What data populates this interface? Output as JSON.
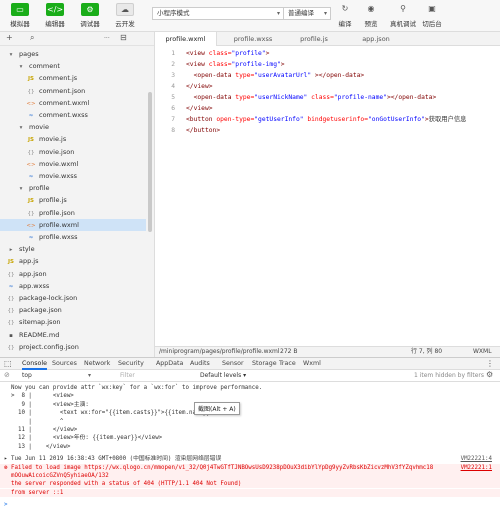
{
  "toolbar": {
    "buttons": [
      {
        "label": "模拟器",
        "icon": "simulator-icon"
      },
      {
        "label": "编辑器",
        "icon": "editor-icon"
      },
      {
        "label": "调试器",
        "icon": "debugger-icon"
      },
      {
        "label": "云开发",
        "icon": "cloud-icon"
      }
    ],
    "mode_select": "小程序模式",
    "compile_select": "普通编译",
    "right_buttons": [
      {
        "label": "编译",
        "icon": "compile-icon"
      },
      {
        "label": "预览",
        "icon": "preview-icon"
      },
      {
        "label": "真机调试",
        "icon": "remote-debug-icon"
      },
      {
        "label": "切后台",
        "icon": "background-icon"
      }
    ]
  },
  "explorer": {
    "add_glyph": "+",
    "search_glyph": "⌕",
    "more_glyph": "···",
    "collapse_glyph": "⊟",
    "items": [
      {
        "label": "pages",
        "type": "folder",
        "open": true,
        "level": 0
      },
      {
        "label": "comment",
        "type": "folder",
        "open": true,
        "level": 1
      },
      {
        "label": "comment.js",
        "type": "js",
        "level": 2
      },
      {
        "label": "comment.json",
        "type": "json",
        "level": 2
      },
      {
        "label": "comment.wxml",
        "type": "wxml",
        "level": 2
      },
      {
        "label": "comment.wxss",
        "type": "wxss",
        "level": 2
      },
      {
        "label": "movie",
        "type": "folder",
        "open": true,
        "level": 1
      },
      {
        "label": "movie.js",
        "type": "js",
        "level": 2
      },
      {
        "label": "movie.json",
        "type": "json",
        "level": 2
      },
      {
        "label": "movie.wxml",
        "type": "wxml",
        "level": 2
      },
      {
        "label": "movie.wxss",
        "type": "wxss",
        "level": 2
      },
      {
        "label": "profile",
        "type": "folder",
        "open": true,
        "level": 1
      },
      {
        "label": "profile.js",
        "type": "js",
        "level": 2
      },
      {
        "label": "profile.json",
        "type": "json",
        "level": 2
      },
      {
        "label": "profile.wxml",
        "type": "wxml",
        "level": 2,
        "selected": true
      },
      {
        "label": "profile.wxss",
        "type": "wxss",
        "level": 2
      },
      {
        "label": "style",
        "type": "folder",
        "open": false,
        "level": 0
      },
      {
        "label": "app.js",
        "type": "js",
        "level": 0
      },
      {
        "label": "app.json",
        "type": "json",
        "level": 0
      },
      {
        "label": "app.wxss",
        "type": "wxss",
        "level": 0
      },
      {
        "label": "package-lock.json",
        "type": "json",
        "level": 0
      },
      {
        "label": "package.json",
        "type": "json",
        "level": 0
      },
      {
        "label": "sitemap.json",
        "type": "json",
        "level": 0
      },
      {
        "label": "README.md",
        "type": "md",
        "level": 0
      },
      {
        "label": "project.config.json",
        "type": "json",
        "level": 0
      }
    ]
  },
  "editor": {
    "tabs": [
      "profile.wxml",
      "profile.wxss",
      "profile.js",
      "app.json"
    ],
    "active_tab": 0,
    "lines": [
      [
        [
          "tg",
          "<view "
        ],
        [
          "at",
          "class="
        ],
        [
          "st",
          "\"profile\""
        ],
        [
          "tg",
          ">"
        ]
      ],
      [
        [
          "tg",
          "<view "
        ],
        [
          "at",
          "class="
        ],
        [
          "st",
          "\"profile-img\""
        ],
        [
          "tg",
          ">"
        ]
      ],
      [
        [
          "",
          "  "
        ],
        [
          "tg",
          "<open-data "
        ],
        [
          "at",
          "type="
        ],
        [
          "st",
          "\"userAvatarUrl\""
        ],
        [
          "tg",
          " ></open-data>"
        ]
      ],
      [
        [
          "tg",
          "</view>"
        ]
      ],
      [
        [
          "",
          "  "
        ],
        [
          "tg",
          "<open-data "
        ],
        [
          "at",
          "type="
        ],
        [
          "st",
          "\"userNickName\""
        ],
        [
          "at",
          " class="
        ],
        [
          "st",
          "\"profile-name\""
        ],
        [
          "tg",
          "></open-data>"
        ]
      ],
      [
        [
          "tg",
          "</view>"
        ]
      ],
      [
        [
          "tg",
          "<button "
        ],
        [
          "at",
          "open-type="
        ],
        [
          "st",
          "\"getUserInfo\""
        ],
        [
          "at",
          " bindgetuserinfo="
        ],
        [
          "st",
          "\"onGotUserInfo\""
        ],
        [
          "tg",
          ">"
        ],
        [
          "",
          "获取用户信息"
        ]
      ],
      [
        [
          "tg",
          "</button>"
        ]
      ]
    ]
  },
  "statusbar": {
    "path": "/miniprogram/pages/profile/profile.wxml",
    "size": "272 B",
    "position": "行 7, 列 80",
    "lang": "WXML"
  },
  "devtools": {
    "tabs": [
      "Console",
      "Sources",
      "Network",
      "Security",
      "AppData",
      "Audits",
      "Sensor",
      "Storage",
      "Trace",
      "Wxml"
    ],
    "active_tab": 0,
    "context": "top",
    "filter_placeholder": "Filter",
    "levels": "Default levels ▾",
    "hidden": "1 item hidden by filters",
    "tooltip": "截图(Alt + A)",
    "console_lines": [
      {
        "text": "  Now you can provide attr `wx:key` for a `wx:for` to improve performance.",
        "err": false
      },
      {
        "text": "  >  8 |      <view>",
        "err": false
      },
      {
        "text": "     9 |      <view>主演:",
        "err": false
      },
      {
        "text": "    10 |        <text wx:for=\"{{item.casts}}\">{{item.name}}</text>",
        "err": false
      },
      {
        "text": "       |        ^",
        "err": false
      },
      {
        "text": "    11 |      </view>",
        "err": false
      },
      {
        "text": "    12 |      <view>年份: {{item.year}}</view>",
        "err": false
      },
      {
        "text": "    13 |    </view>",
        "err": false
      },
      {
        "text": "▸ Tue Jun 11 2019 16:38:43 GMT+0800 (中国标准时间) 渲染层网络层错误",
        "err": false,
        "ref": "VM22221:4"
      },
      {
        "text": "⊗ Failed to load image https://wx.qlogo.cn/mmopen/vi_32/Q0j4TwGTfTJNBOwsUsD9238pDOuX3dibYlYpDg9yyZvRbsKbZicvzMhV3fYZqvhmc18",
        "err": true,
        "ref": "VM22221:1"
      },
      {
        "text": "  mOOuwAicoicGZVnQ5yhiaeOA/132",
        "err": true
      },
      {
        "text": "  the server responded with a status of 404 (HTTP/1.1 404 Not Found)",
        "err": true
      },
      {
        "text": "  from server ::1",
        "err": true
      }
    ],
    "prompt": ">"
  }
}
